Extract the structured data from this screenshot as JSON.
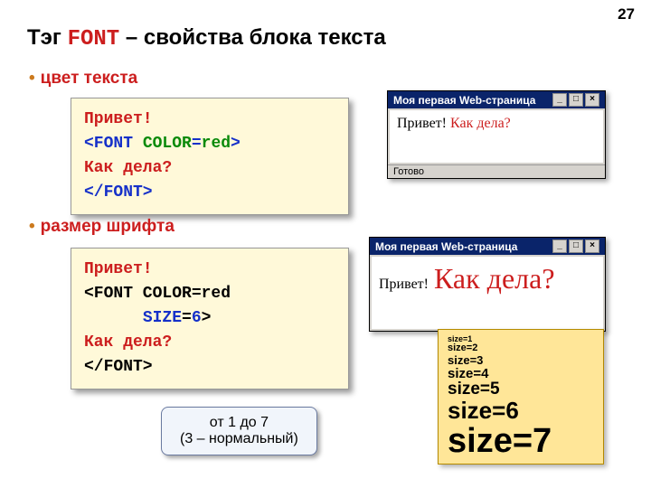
{
  "page_number": "27",
  "heading_prefix": "Тэг ",
  "heading_kw": "FONT",
  "heading_suffix": " – свойства блока текста",
  "bullet1": "цвет текста",
  "bullet2": "размер шрифта",
  "code1": {
    "l1": "Привет!",
    "l2a": "<FONT ",
    "l2b": "COLOR",
    "l2c": "=",
    "l2d": "red",
    "l2e": ">",
    "l3": "Как дела?",
    "l4": "</FONT>"
  },
  "code2": {
    "l1": "Привет!",
    "l2": "<FONT COLOR=red",
    "l3a": "      ",
    "l3b": "SIZE",
    "l3c": "=",
    "l3d": "6",
    "l3e": ">",
    "l4": "Как дела?",
    "l5": "</FONT>"
  },
  "win1": {
    "title": "Моя первая Web-страница",
    "body_a": "Привет! ",
    "body_b": "Как дела?",
    "status": "Готово"
  },
  "win2": {
    "title": "Моя первая Web-страница",
    "body_a": "Привет!",
    "body_b": "Как дела?"
  },
  "sizes": {
    "s1": "size=1",
    "s2": "size=2",
    "s3": "size=3",
    "s4": "size=4",
    "s5": "size=5",
    "s6": "size=6",
    "s7": "size=7"
  },
  "callout_line1": "от 1 до 7",
  "callout_line2": "(3 – нормальный)"
}
